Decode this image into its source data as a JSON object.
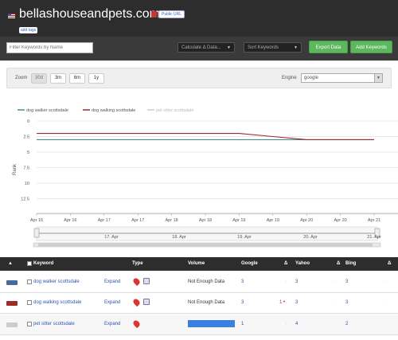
{
  "header": {
    "site_title": "bellashouseandpets.com",
    "public_label": "Public URL",
    "add_tags_label": "add tags"
  },
  "toolbar": {
    "filter_placeholder": "Filter Keywords by Name",
    "calculate_label": "Calculate Δ Data...",
    "sort_label": "Sort Keywords",
    "export_label": "Export Data",
    "add_keywords_label": "Add Keywords"
  },
  "zoom": {
    "label": "Zoom",
    "options": [
      "30d",
      "3m",
      "6m",
      "1y"
    ],
    "selected": "30d",
    "engine_label": "Engine",
    "engine_value": "google"
  },
  "chart_data": {
    "type": "line",
    "ylabel": "Rank",
    "ylim": [
      0,
      15
    ],
    "yticks": [
      "0",
      "2.5",
      "5",
      "7.5",
      "10",
      "12.5"
    ],
    "x": [
      "Apr 16",
      "Apr 16",
      "Apr 17",
      "Apr 17",
      "Apr 18",
      "Apr 18",
      "Apr 19",
      "Apr 19",
      "Apr 20",
      "Apr 20",
      "Apr 21"
    ],
    "navigator_labels": [
      "17. Apr",
      "18. Apr",
      "19. Apr",
      "20. Apr",
      "21. Apr"
    ],
    "series": [
      {
        "name": "dog walker scottsdale",
        "color": "#4a8a8a",
        "values": [
          3,
          3,
          3,
          3,
          3,
          3,
          3,
          3,
          3,
          3,
          3
        ]
      },
      {
        "name": "dog walking scottsdale",
        "color": "#9b2c2c",
        "values": [
          2,
          2,
          2,
          2,
          2,
          2,
          2,
          2.5,
          3,
          3,
          3
        ]
      },
      {
        "name": "pet sitter scottsdale",
        "color": "#cccccc",
        "values": []
      }
    ]
  },
  "table": {
    "headers": {
      "keyword": "Keyword",
      "type": "Type",
      "volume": "Volume",
      "google": "Google",
      "yahoo": "Yahoo",
      "bing": "Bing",
      "delta": "Δ"
    },
    "expand_label": "Expand",
    "rows": [
      {
        "keyword": "dog walker scottsdale",
        "volume": "Not Enough Data",
        "google": "3",
        "google_delta": "",
        "yahoo": "3",
        "bing": "3",
        "swatch": "#4a6a9a"
      },
      {
        "keyword": "dog walking scottsdale",
        "volume": "Not Enough Data",
        "google": "3",
        "google_delta": "1",
        "yahoo": "3",
        "bing": "3",
        "swatch": "#9b2c2c"
      },
      {
        "keyword": "pet sitter scottsdale",
        "volume": "",
        "volume_fill": 1.0,
        "google": "1",
        "google_delta": "",
        "yahoo": "4",
        "bing": "2",
        "swatch": "#cccccc"
      }
    ],
    "dot": "."
  }
}
